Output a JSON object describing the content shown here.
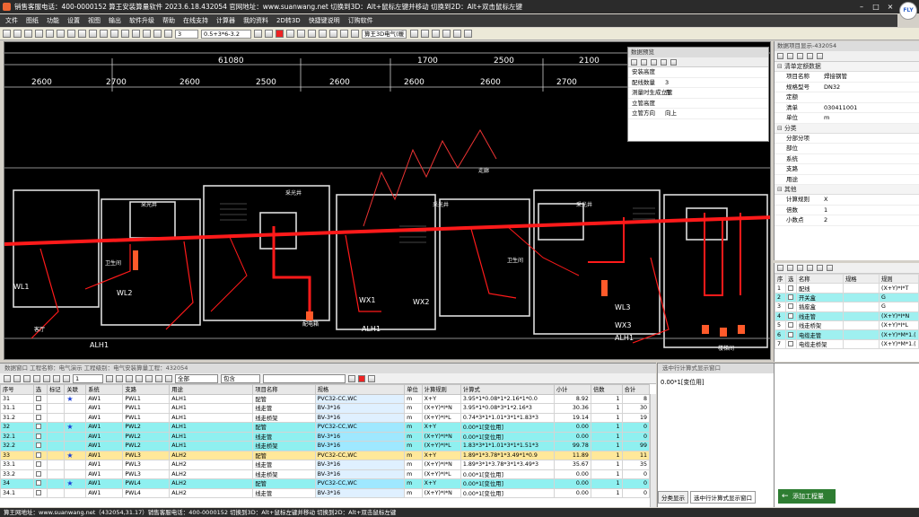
{
  "window": {
    "title": "销售客服电话：400-0000152  算王安装算量软件 2023.6.18.432054 官网地址：www.suanwang.net  切换到3D：Alt+鼠标左键并移动  切换到2D：Alt+双击鼠标左键",
    "badge": "FLY"
  },
  "menu": [
    "文件",
    "图纸",
    "功能",
    "设置",
    "视图",
    "输出",
    "软件升级",
    "帮助",
    "在线支持",
    "计算器",
    "我的资料",
    "2D转3D",
    "快捷键说明",
    "订购软件"
  ],
  "toolbar": {
    "layer_value": "3",
    "scale_text": "0.5+3*6-3.2",
    "mode_label": "算王3D电气(暖"
  },
  "cad": {
    "dims_top": [
      "61080",
      "1700",
      "2500",
      "2100"
    ],
    "dims_row": [
      "2600",
      "2700",
      "2600",
      "2500",
      "2600",
      "2600",
      "2600",
      "2700"
    ],
    "room_labels": [
      "采光井",
      "采光井",
      "采光井",
      "采光井",
      "卫生间",
      "卫生间",
      "配电箱",
      "客厅",
      "走廊",
      "楼梯间"
    ],
    "box_labels": [
      "WL1",
      "WL2",
      "WX1",
      "WX2",
      "WL3",
      "WX3",
      "ALH1",
      "ALH1",
      "ALH1"
    ]
  },
  "data_preview": {
    "title": "数据预览",
    "rows": [
      {
        "k": "安装高度",
        "v": ""
      },
      {
        "k": "配线数量",
        "v": "3"
      },
      {
        "k": "测量时生成立管",
        "v": "否"
      },
      {
        "k": "立管高度",
        "v": ""
      },
      {
        "k": "立管方向",
        "v": "向上"
      }
    ]
  },
  "properties": {
    "title": "数据项目显示-432054",
    "sections": [
      {
        "name": "清单定额数据",
        "rows": [
          {
            "k": "项目名称",
            "v": "焊接钢管"
          },
          {
            "k": "规格型号",
            "v": "DN32"
          },
          {
            "k": "定额",
            "v": ""
          },
          {
            "k": "清单",
            "v": "030411001"
          },
          {
            "k": "单位",
            "v": "m"
          }
        ]
      },
      {
        "name": "分类",
        "rows": [
          {
            "k": "分部分项",
            "v": ""
          },
          {
            "k": "部位",
            "v": ""
          },
          {
            "k": "系统",
            "v": ""
          },
          {
            "k": "支路",
            "v": ""
          },
          {
            "k": "用途",
            "v": ""
          }
        ]
      },
      {
        "name": "其他",
        "rows": [
          {
            "k": "计算规则",
            "v": "X"
          },
          {
            "k": "倍数",
            "v": "1"
          },
          {
            "k": "小数点",
            "v": "2"
          }
        ]
      }
    ]
  },
  "legend": {
    "headers": [
      "序",
      "选",
      "名称",
      "规格",
      "规则"
    ],
    "rows": [
      {
        "no": "1",
        "name": "配线",
        "spec": "",
        "rule": "(X+Y)*I*T"
      },
      {
        "no": "2",
        "name": "开关盒",
        "spec": "",
        "rule": "G"
      },
      {
        "no": "3",
        "name": "插座盒",
        "spec": "",
        "rule": "G"
      },
      {
        "no": "4",
        "name": "线走管",
        "spec": "",
        "rule": "(X+Y)*I*N"
      },
      {
        "no": "5",
        "name": "线走桥架",
        "spec": "",
        "rule": "(X+Y)*I*L"
      },
      {
        "no": "6",
        "name": "电缆走管",
        "spec": "",
        "rule": "(X+Y)*M*1.("
      },
      {
        "no": "7",
        "name": "电缆走桥架",
        "spec": "",
        "rule": "(X+Y)*M*1.("
      }
    ]
  },
  "bottom": {
    "title": "数据窗口  工程名称：电气演示  工程级别：电气安装算量工程：432054",
    "filter1": "1",
    "filter2": "全部",
    "filter3": "包含",
    "headers": [
      "序号",
      "选",
      "标记",
      "关联",
      "系统",
      "支路",
      "用途",
      "项目名称",
      "规格",
      "单位",
      "计算规则",
      "计算式",
      "小计",
      "倍数",
      "合计"
    ],
    "rows": [
      {
        "no": "31",
        "star": true,
        "sys": "AW1",
        "branch": "PWL1",
        "use": "ALH1",
        "name": "配管",
        "spec": "PVC32-CC,WC",
        "unit": "m",
        "rule": "X+Y",
        "formula": "3.95*1*0.08*1*2.16*1*0.0",
        "subtotal": "8.92",
        "mult": "1",
        "total": "8",
        "style": ""
      },
      {
        "no": "31.1",
        "star": false,
        "sys": "AW1",
        "branch": "PWL1",
        "use": "ALH1",
        "name": "线走管",
        "spec": "BV-3*16",
        "unit": "m",
        "rule": "(X+Y)*I*N",
        "formula": "3.95*1*0.08*3*1*2.16*3",
        "subtotal": "30.36",
        "mult": "1",
        "total": "30",
        "style": ""
      },
      {
        "no": "31.2",
        "star": false,
        "sys": "AW1",
        "branch": "PWL1",
        "use": "ALH1",
        "name": "线走桥架",
        "spec": "BV-3*16",
        "unit": "m",
        "rule": "(X+Y)*I*L",
        "formula": "0.74*3*1*1.01*3*1*1.83*3",
        "subtotal": "19.14",
        "mult": "1",
        "total": "19",
        "style": ""
      },
      {
        "no": "32",
        "star": true,
        "sys": "AW1",
        "branch": "PWL2",
        "use": "ALH1",
        "name": "配管",
        "spec": "PVC32-CC,WC",
        "unit": "m",
        "rule": "X+Y",
        "formula": "0.00*1[变位用]",
        "subtotal": "0.00",
        "mult": "1",
        "total": "0",
        "style": "cy"
      },
      {
        "no": "32.1",
        "star": false,
        "sys": "AW1",
        "branch": "PWL2",
        "use": "ALH1",
        "name": "线走管",
        "spec": "BV-3*16",
        "unit": "m",
        "rule": "(X+Y)*I*N",
        "formula": "0.00*1[变位用]",
        "subtotal": "0.00",
        "mult": "1",
        "total": "0",
        "style": "cy"
      },
      {
        "no": "32.2",
        "star": false,
        "sys": "AW1",
        "branch": "PWL2",
        "use": "ALH1",
        "name": "线走桥架",
        "spec": "BV-3*16",
        "unit": "m",
        "rule": "(X+Y)*I*L",
        "formula": "1.83*3*1*1.01*3*1*1.51*3",
        "subtotal": "99.78",
        "mult": "1",
        "total": "99",
        "style": "cy"
      },
      {
        "no": "33",
        "star": true,
        "sys": "AW1",
        "branch": "PWL3",
        "use": "ALH2",
        "name": "配管",
        "spec": "PVC32-CC,WC",
        "unit": "m",
        "rule": "X+Y",
        "formula": "1.89*1*3.78*1*3.49*1*0.9",
        "subtotal": "11.89",
        "mult": "1",
        "total": "11",
        "style": "sel"
      },
      {
        "no": "33.1",
        "star": false,
        "sys": "AW1",
        "branch": "PWL3",
        "use": "ALH2",
        "name": "线走管",
        "spec": "BV-3*16",
        "unit": "m",
        "rule": "(X+Y)*I*N",
        "formula": "1.89*3*1*3.78*3*1*3.49*3",
        "subtotal": "35.67",
        "mult": "1",
        "total": "35",
        "style": ""
      },
      {
        "no": "33.2",
        "star": false,
        "sys": "AW1",
        "branch": "PWL3",
        "use": "ALH2",
        "name": "线走桥架",
        "spec": "BV-3*16",
        "unit": "m",
        "rule": "(X+Y)*I*L",
        "formula": "0.00*1[变位用]",
        "subtotal": "0.00",
        "mult": "1",
        "total": "0",
        "style": ""
      },
      {
        "no": "34",
        "star": true,
        "sys": "AW1",
        "branch": "PWL4",
        "use": "ALH2",
        "name": "配管",
        "spec": "PVC32-CC,WC",
        "unit": "m",
        "rule": "X+Y",
        "formula": "0.00*1[变位用]",
        "subtotal": "0.00",
        "mult": "1",
        "total": "0",
        "style": "cy"
      },
      {
        "no": "34.1",
        "star": false,
        "sys": "AW1",
        "branch": "PWL4",
        "use": "ALH2",
        "name": "线走管",
        "spec": "BV-3*16",
        "unit": "m",
        "rule": "(X+Y)*I*N",
        "formula": "0.00*1[变位用]",
        "subtotal": "0.00",
        "mult": "1",
        "total": "0",
        "style": ""
      }
    ]
  },
  "formula_panel": {
    "title": "选中行计算式显示窗口",
    "text": "0.00*1[变位用]",
    "tabs": [
      "分类显示",
      "选中行计算式显示窗口"
    ]
  },
  "add_button": "添加工程量",
  "status": "算王网地址：www.suanwang.net（432054,31.17）销售客服电话：400-0000152  切换到3D：Alt+鼠标左键并移动  切换到2D：Alt+双击鼠标左键",
  "colors": {
    "accent_red": "#ff1a1a",
    "cad_bg": "#000000",
    "row_cyan": "#8ff0f0",
    "row_selected": "#ffe89a"
  }
}
